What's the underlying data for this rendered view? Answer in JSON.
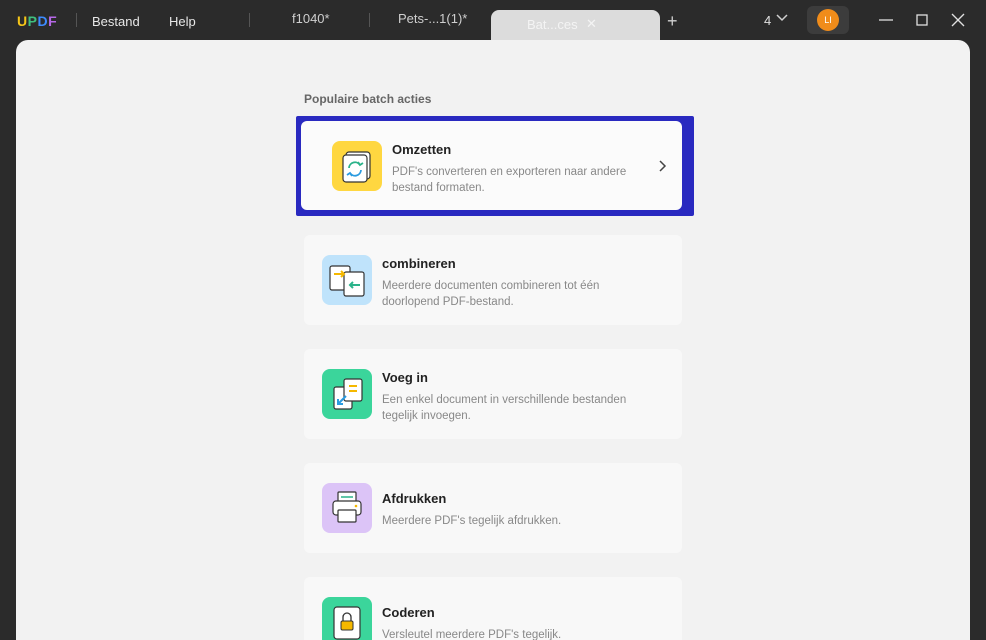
{
  "app": {
    "logo": [
      "U",
      "P",
      "D",
      "F"
    ],
    "menu": {
      "file": "Bestand",
      "help": "Help"
    }
  },
  "tabs": [
    {
      "label": "f1040*"
    },
    {
      "label": "Pets-...1(1)*"
    },
    {
      "label": "Bat...ces",
      "active": true
    }
  ],
  "toolbar": {
    "window_count": "4",
    "avatar_initials": "LI"
  },
  "main": {
    "section_title": "Populaire batch acties",
    "actions": [
      {
        "title": "Omzetten",
        "desc": "PDF's converteren en exporteren naar andere bestand formaten.",
        "icon": "convert-icon",
        "color": "#ffd740"
      },
      {
        "title": "combineren",
        "desc": "Meerdere documenten combineren tot één doorlopend PDF-bestand.",
        "icon": "combine-icon",
        "color": "#bfe3fb"
      },
      {
        "title": "Voeg in",
        "desc": "Een enkel document in verschillende bestanden tegelijk invoegen.",
        "icon": "insert-icon",
        "color": "#3bd59b"
      },
      {
        "title": "Afdrukken",
        "desc": "Meerdere PDF's tegelijk afdrukken.",
        "icon": "print-icon",
        "color": "#dcc4f7"
      },
      {
        "title": "Coderen",
        "desc": "Versleutel meerdere PDF's tegelijk.",
        "icon": "lock-icon",
        "color": "#3bd59b"
      }
    ]
  },
  "colors": {
    "highlight": "#2929c0",
    "accent_orange": "#f08c1a"
  }
}
